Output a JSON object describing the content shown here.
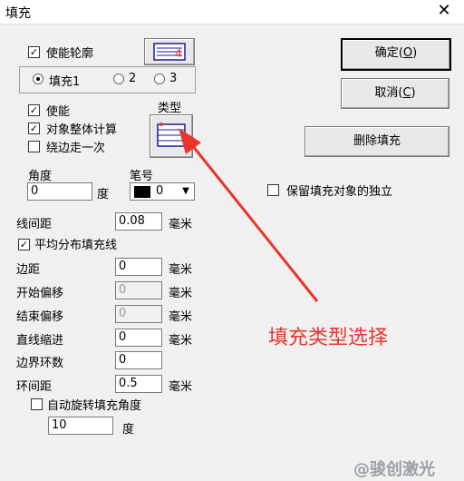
{
  "window": {
    "title": "填充",
    "close_glyph": "✕"
  },
  "contour": {
    "enable_label": "使能轮廓",
    "checked": true
  },
  "fill_radios": {
    "r1": "填充1",
    "r2": "2",
    "r3": "3",
    "selected": "r1"
  },
  "enable": {
    "label": "使能",
    "checked": true
  },
  "whole_calc": {
    "label": "对象整体计算",
    "checked": true
  },
  "edge_once": {
    "label": "绕边走一次",
    "checked": false
  },
  "type": {
    "label": "类型"
  },
  "angle": {
    "label": "角度",
    "value": "0",
    "unit": "度"
  },
  "pen": {
    "label": "笔号",
    "value": "0",
    "color": "#000000"
  },
  "line_spacing": {
    "label": "线间距",
    "value": "0.08",
    "unit": "毫米"
  },
  "even_dist": {
    "label": "平均分布填充线",
    "checked": true
  },
  "margin": {
    "label": "边距",
    "value": "0",
    "unit": "毫米"
  },
  "start_offset": {
    "label": "开始偏移",
    "value": "0",
    "unit": "毫米"
  },
  "end_offset": {
    "label": "结束偏移",
    "value": "0",
    "unit": "毫米"
  },
  "line_shrink": {
    "label": "直线缩进",
    "value": "0",
    "unit": "毫米"
  },
  "boundary_rings": {
    "label": "边界环数",
    "value": "0"
  },
  "ring_spacing": {
    "label": "环间距",
    "value": "0.5",
    "unit": "毫米"
  },
  "auto_rotate": {
    "label": "自动旋转填充角度",
    "checked": false,
    "value": "10",
    "unit": "度"
  },
  "buttons": {
    "ok_text": "确定",
    "ok_key": "O",
    "cancel_text": "取消",
    "cancel_key": "C",
    "delete": "删除填充"
  },
  "keep_independent": {
    "label": "保留填充对象的独立",
    "checked": false
  },
  "annotation": {
    "text": "填充类型选择",
    "color": "#e8362d"
  },
  "watermark": {
    "text": "@骏创激光"
  }
}
